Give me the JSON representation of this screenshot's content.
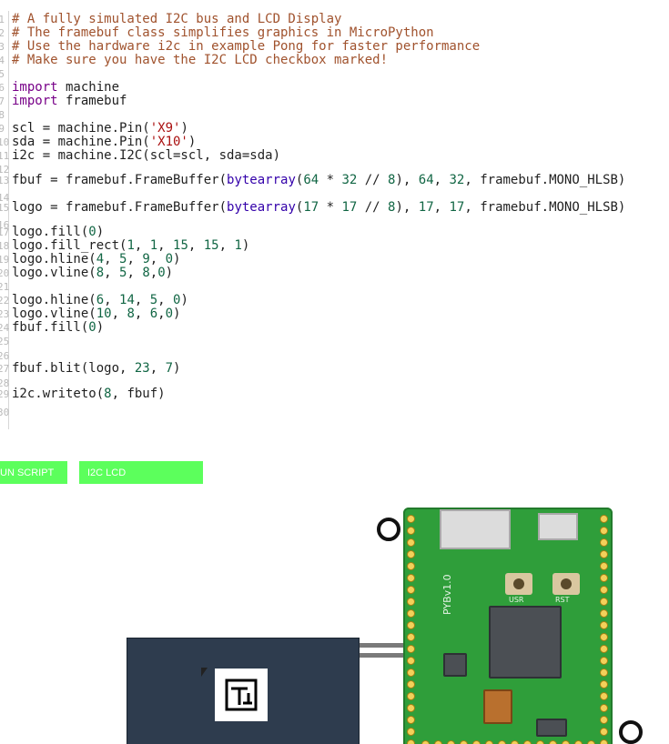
{
  "editor": {
    "lines": [
      {
        "n": "1",
        "parts": [
          {
            "t": "# A fully simulated I2C bus and LCD Display",
            "c": "cm"
          }
        ]
      },
      {
        "n": "2",
        "parts": [
          {
            "t": "# The framebuf class simplifies graphics in MicroPython",
            "c": "cm"
          }
        ]
      },
      {
        "n": "3",
        "parts": [
          {
            "t": "# Use the hardware i2c in example Pong for faster performance",
            "c": "cm"
          }
        ]
      },
      {
        "n": "4",
        "parts": [
          {
            "t": "# Make sure you have the I2C LCD checkbox marked!",
            "c": "cm"
          }
        ]
      },
      {
        "n": "5",
        "parts": []
      },
      {
        "n": "6",
        "parts": [
          {
            "t": "import",
            "c": "kw"
          },
          {
            "t": " machine",
            "c": ""
          }
        ]
      },
      {
        "n": "7",
        "parts": [
          {
            "t": "import",
            "c": "kw"
          },
          {
            "t": " framebuf",
            "c": ""
          }
        ]
      },
      {
        "n": "8",
        "parts": []
      },
      {
        "n": "9",
        "parts": [
          {
            "t": "scl = machine.Pin(",
            "c": ""
          },
          {
            "t": "'X9'",
            "c": "str"
          },
          {
            "t": ")",
            "c": ""
          }
        ]
      },
      {
        "n": "10",
        "parts": [
          {
            "t": "sda = machine.Pin(",
            "c": ""
          },
          {
            "t": "'X10'",
            "c": "str"
          },
          {
            "t": ")",
            "c": ""
          }
        ]
      },
      {
        "n": "11",
        "parts": [
          {
            "t": "i2c = machine.I2C(scl=scl, sda=sda)",
            "c": ""
          }
        ]
      },
      {
        "n": "12",
        "parts": []
      },
      {
        "n": "13",
        "parts": [
          {
            "t": "fbuf = framebuf.FrameBuffer(",
            "c": ""
          },
          {
            "t": "bytearray",
            "c": "bi"
          },
          {
            "t": "(",
            "c": ""
          },
          {
            "t": "64",
            "c": "num"
          },
          {
            "t": " * ",
            "c": ""
          },
          {
            "t": "32",
            "c": "num"
          },
          {
            "t": " // ",
            "c": ""
          },
          {
            "t": "8",
            "c": "num"
          },
          {
            "t": "), ",
            "c": ""
          },
          {
            "t": "64",
            "c": "num"
          },
          {
            "t": ", ",
            "c": ""
          },
          {
            "t": "32",
            "c": "num"
          },
          {
            "t": ", framebuf.MONO_HLSB)",
            "c": ""
          }
        ]
      },
      {
        "n": "14",
        "parts": []
      },
      {
        "n": "15",
        "parts": [
          {
            "t": "logo = framebuf.FrameBuffer(",
            "c": ""
          },
          {
            "t": "bytearray",
            "c": "bi"
          },
          {
            "t": "(",
            "c": ""
          },
          {
            "t": "17",
            "c": "num"
          },
          {
            "t": " * ",
            "c": ""
          },
          {
            "t": "17",
            "c": "num"
          },
          {
            "t": " // ",
            "c": ""
          },
          {
            "t": "8",
            "c": "num"
          },
          {
            "t": "), ",
            "c": ""
          },
          {
            "t": "17",
            "c": "num"
          },
          {
            "t": ", ",
            "c": ""
          },
          {
            "t": "17",
            "c": "num"
          },
          {
            "t": ", framebuf.MONO_HLSB)",
            "c": ""
          }
        ]
      },
      {
        "n": "16",
        "parts": []
      },
      {
        "n": "17",
        "parts": [
          {
            "t": "logo.fill(",
            "c": ""
          },
          {
            "t": "0",
            "c": "num"
          },
          {
            "t": ")",
            "c": ""
          }
        ]
      },
      {
        "n": "18",
        "parts": [
          {
            "t": "logo.fill_rect(",
            "c": ""
          },
          {
            "t": "1",
            "c": "num"
          },
          {
            "t": ", ",
            "c": ""
          },
          {
            "t": "1",
            "c": "num"
          },
          {
            "t": ", ",
            "c": ""
          },
          {
            "t": "15",
            "c": "num"
          },
          {
            "t": ", ",
            "c": ""
          },
          {
            "t": "15",
            "c": "num"
          },
          {
            "t": ", ",
            "c": ""
          },
          {
            "t": "1",
            "c": "num"
          },
          {
            "t": ")",
            "c": ""
          }
        ]
      },
      {
        "n": "19",
        "parts": [
          {
            "t": "logo.hline(",
            "c": ""
          },
          {
            "t": "4",
            "c": "num"
          },
          {
            "t": ", ",
            "c": ""
          },
          {
            "t": "5",
            "c": "num"
          },
          {
            "t": ", ",
            "c": ""
          },
          {
            "t": "9",
            "c": "num"
          },
          {
            "t": ", ",
            "c": ""
          },
          {
            "t": "0",
            "c": "num"
          },
          {
            "t": ")",
            "c": ""
          }
        ]
      },
      {
        "n": "20",
        "parts": [
          {
            "t": "logo.vline(",
            "c": ""
          },
          {
            "t": "8",
            "c": "num"
          },
          {
            "t": ", ",
            "c": ""
          },
          {
            "t": "5",
            "c": "num"
          },
          {
            "t": ", ",
            "c": ""
          },
          {
            "t": "8",
            "c": "num"
          },
          {
            "t": ",",
            "c": ""
          },
          {
            "t": "0",
            "c": "num"
          },
          {
            "t": ")",
            "c": ""
          }
        ]
      },
      {
        "n": "21",
        "parts": []
      },
      {
        "n": "22",
        "parts": [
          {
            "t": "logo.hline(",
            "c": ""
          },
          {
            "t": "6",
            "c": "num"
          },
          {
            "t": ", ",
            "c": ""
          },
          {
            "t": "14",
            "c": "num"
          },
          {
            "t": ", ",
            "c": ""
          },
          {
            "t": "5",
            "c": "num"
          },
          {
            "t": ", ",
            "c": ""
          },
          {
            "t": "0",
            "c": "num"
          },
          {
            "t": ")",
            "c": ""
          }
        ]
      },
      {
        "n": "23",
        "parts": [
          {
            "t": "logo.vline(",
            "c": ""
          },
          {
            "t": "10",
            "c": "num"
          },
          {
            "t": ", ",
            "c": ""
          },
          {
            "t": "8",
            "c": "num"
          },
          {
            "t": ", ",
            "c": ""
          },
          {
            "t": "6",
            "c": "num"
          },
          {
            "t": ",",
            "c": ""
          },
          {
            "t": "0",
            "c": "num"
          },
          {
            "t": ")",
            "c": ""
          }
        ]
      },
      {
        "n": "24",
        "parts": [
          {
            "t": "fbuf.fill(",
            "c": ""
          },
          {
            "t": "0",
            "c": "num"
          },
          {
            "t": ")",
            "c": ""
          }
        ]
      },
      {
        "n": "25",
        "parts": []
      },
      {
        "n": "26",
        "parts": []
      },
      {
        "n": "27",
        "parts": [
          {
            "t": "fbuf.blit(logo, ",
            "c": ""
          },
          {
            "t": "23",
            "c": "num"
          },
          {
            "t": ", ",
            "c": ""
          },
          {
            "t": "7",
            "c": "num"
          },
          {
            "t": ")",
            "c": ""
          }
        ]
      },
      {
        "n": "28",
        "parts": []
      },
      {
        "n": "29",
        "parts": [
          {
            "t": "i2c.writeto(",
            "c": ""
          },
          {
            "t": "8",
            "c": "num"
          },
          {
            "t": ", fbuf)",
            "c": ""
          }
        ]
      },
      {
        "n": "30",
        "parts": []
      }
    ]
  },
  "toolbar": {
    "run_label": "UN SCRIPT",
    "lcd_label": "I2C LCD"
  },
  "board": {
    "name": "PYBv1.0",
    "usr_label": "USR",
    "rst_label": "RST"
  },
  "colors": {
    "button_green": "#5cff5c",
    "pcb_green": "#2f9e3a",
    "lcd_navy": "#2e3c4e",
    "comment": "#a0522d"
  }
}
